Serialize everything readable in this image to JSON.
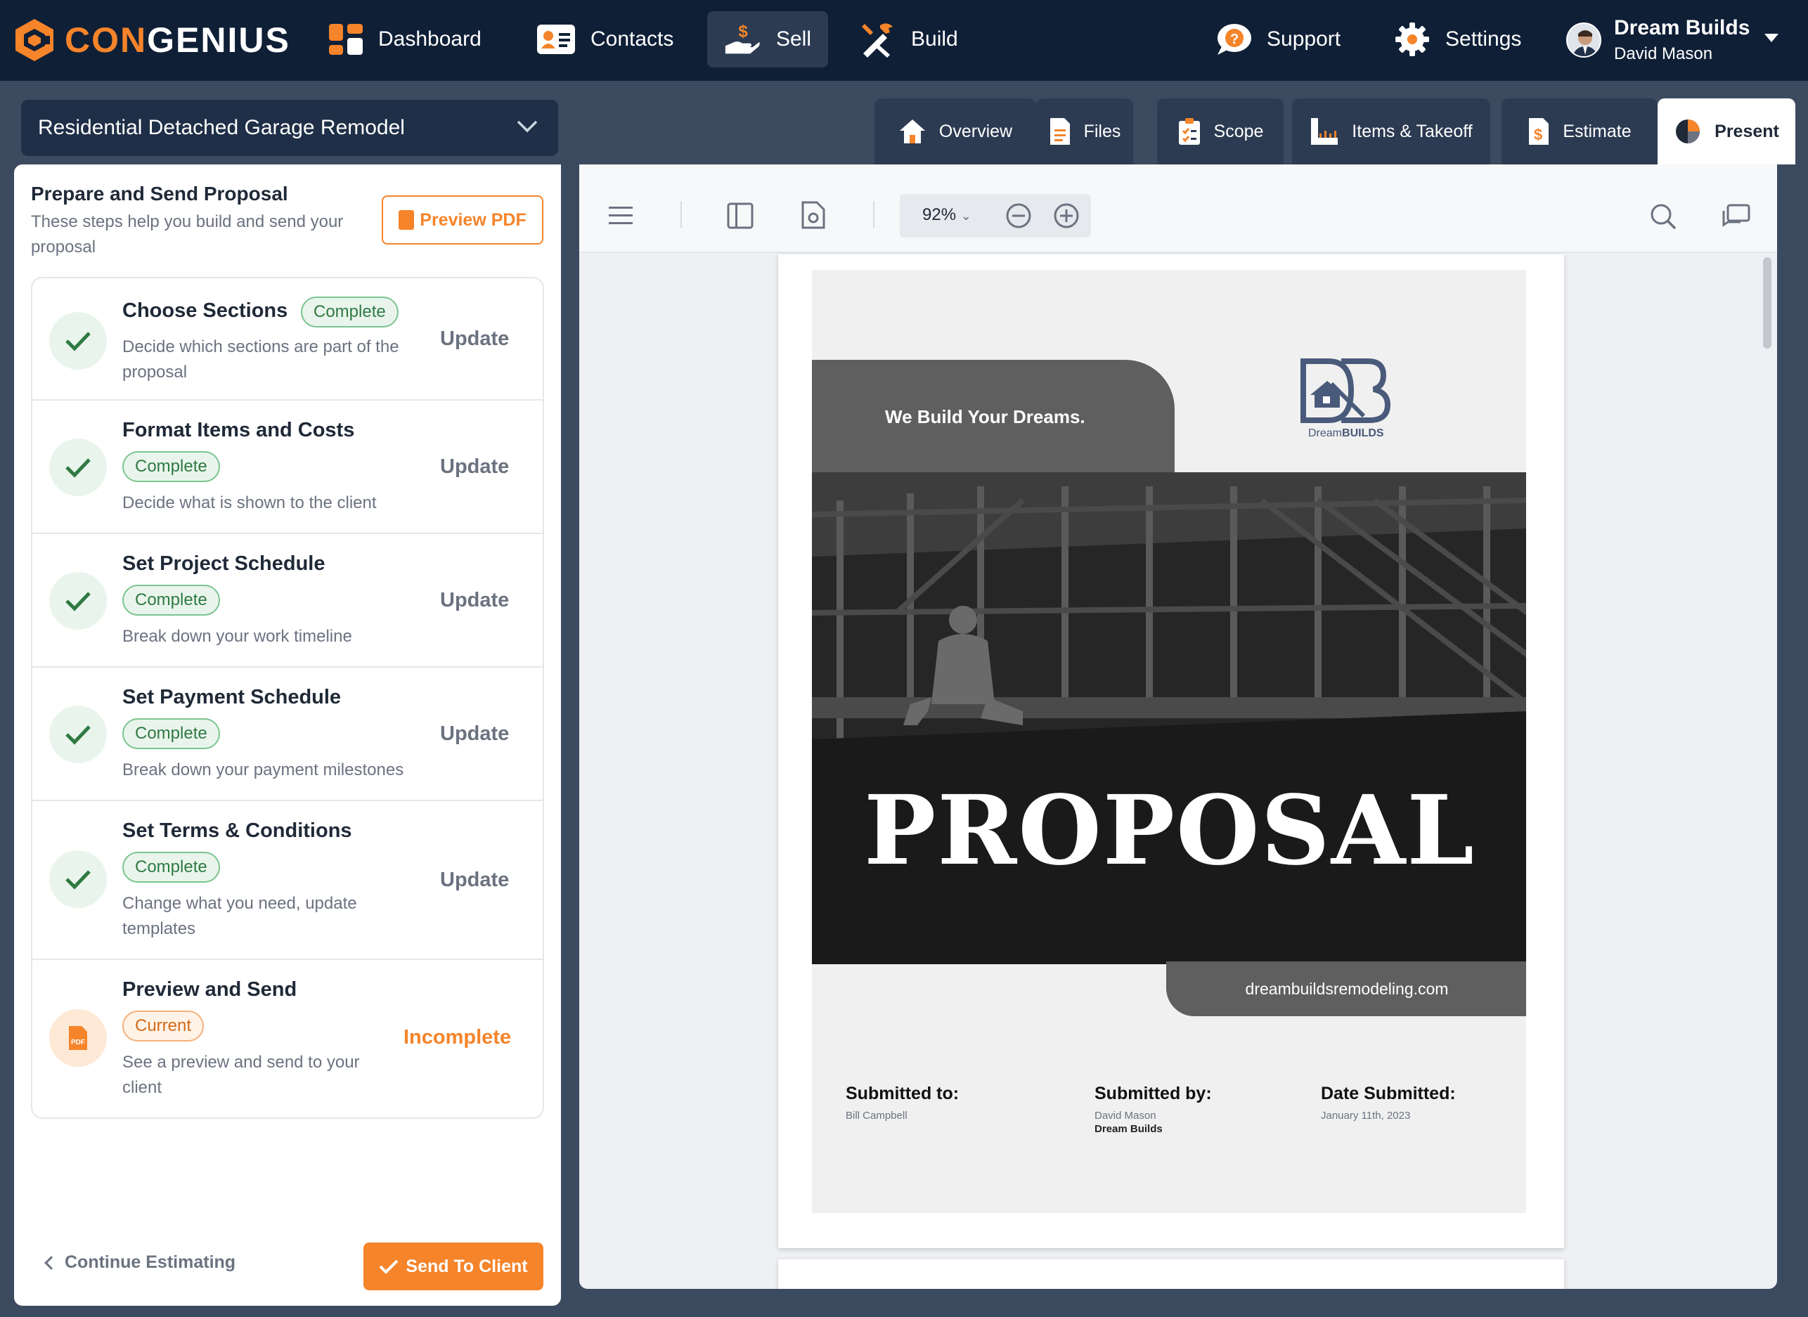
{
  "app": {
    "brand_prefix": "CON",
    "brand_suffix": "GENIUS",
    "accent_color": "#f5842a",
    "nav_color": "#0f1f36"
  },
  "nav": {
    "items": [
      {
        "label": "Dashboard",
        "icon": "dashboard-icon"
      },
      {
        "label": "Contacts",
        "icon": "contacts-card-icon"
      },
      {
        "label": "Sell",
        "icon": "sell-hand-dollar-icon",
        "active": true
      },
      {
        "label": "Build",
        "icon": "build-tools-icon"
      }
    ],
    "support": "Support",
    "settings": "Settings",
    "account": {
      "company": "Dream Builds",
      "user": "David Mason"
    }
  },
  "project": {
    "name": "Residential Detached Garage Remodel"
  },
  "tabs": [
    {
      "label": "Overview",
      "icon": "home-icon"
    },
    {
      "label": "Files",
      "icon": "file-icon"
    },
    {
      "label": "Scope",
      "icon": "clipboard-check-icon"
    },
    {
      "label": "Items & Takeoff",
      "icon": "ruler-icon"
    },
    {
      "label": "Estimate",
      "icon": "estimate-dollar-icon"
    },
    {
      "label": "Present",
      "icon": "pie-chart-icon",
      "active": true
    }
  ],
  "panel": {
    "title": "Prepare and Send Proposal",
    "subtitle": "These steps help you build and send your proposal",
    "preview_pdf": "Preview PDF",
    "steps": [
      {
        "title": "Choose Sections",
        "badge": "Complete",
        "desc": "Decide which sections are part of the proposal",
        "action": "Update",
        "state": "complete"
      },
      {
        "title": "Format Items and Costs",
        "badge": "Complete",
        "desc": "Decide what is shown to the client",
        "action": "Update",
        "state": "complete"
      },
      {
        "title": "Set Project Schedule",
        "badge": "Complete",
        "desc": "Break down your work timeline",
        "action": "Update",
        "state": "complete"
      },
      {
        "title": "Set Payment Schedule",
        "badge": "Complete",
        "desc": "Break down your payment milestones",
        "action": "Update",
        "state": "complete"
      },
      {
        "title": "Set Terms & Conditions",
        "badge": "Complete",
        "desc": "Change what you need, update templates",
        "action": "Update",
        "state": "complete"
      },
      {
        "title": "Preview and Send",
        "badge": "Current",
        "desc": "See a preview and send to your client",
        "action": "Incomplete",
        "state": "current"
      }
    ],
    "continue_label": "Continue Estimating",
    "send_label": "Send To Client"
  },
  "viewer": {
    "zoom": "92%"
  },
  "document": {
    "tagline": "We Build Your Dreams.",
    "logo_prefix": "Dream",
    "logo_suffix": "BUILDS",
    "title": "PROPOSAL",
    "website": "dreambuildsremodeling.com",
    "submitted_to_label": "Submitted to:",
    "submitted_to": "Bill Campbell",
    "submitted_by_label": "Submitted by:",
    "submitted_by": "David Mason",
    "submitted_by_company": "Dream Builds",
    "date_label": "Date Submitted:",
    "date": "January 11th, 2023"
  }
}
